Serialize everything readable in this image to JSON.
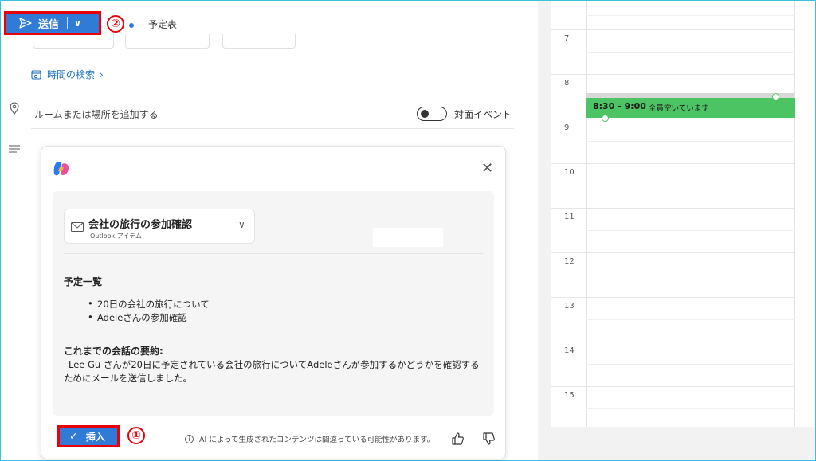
{
  "toolbar": {
    "send_label": "送信",
    "send_badge": "②",
    "schedule_label": "予定表"
  },
  "form": {
    "time_search_label": "時間の検索",
    "location_placeholder": "ルームまたは場所を追加する",
    "in_person_label": "対面イベント",
    "in_person_on": false
  },
  "copilot": {
    "reference": {
      "title": "会社の旅行の参加確認",
      "subtitle": "Outlook アイテム"
    },
    "agenda_title": "予定一覧",
    "agenda_items": [
      "20日の会社の旅行について",
      "Adeleさんの参加確認"
    ],
    "summary_title": "これまでの会話の要約:",
    "summary_text": "Lee Gu さんが20日に予定されている会社の旅行についてAdeleさんが参加するかどうかを確認するためにメールを送信しました。",
    "insert_label": "挿入",
    "insert_badge": "①",
    "disclaimer": "AI によって生成されたコンテンツは間違っている可能性があります。"
  },
  "calendar": {
    "hours": [
      "7",
      "8",
      "9",
      "10",
      "11",
      "12",
      "13",
      "14",
      "15"
    ],
    "event": {
      "time": "8:30 - 9:00",
      "text": "全員空いています",
      "color": "#4cc464"
    }
  },
  "colors": {
    "accent": "#2f7bd6",
    "highlight_border": "#e8000b"
  }
}
